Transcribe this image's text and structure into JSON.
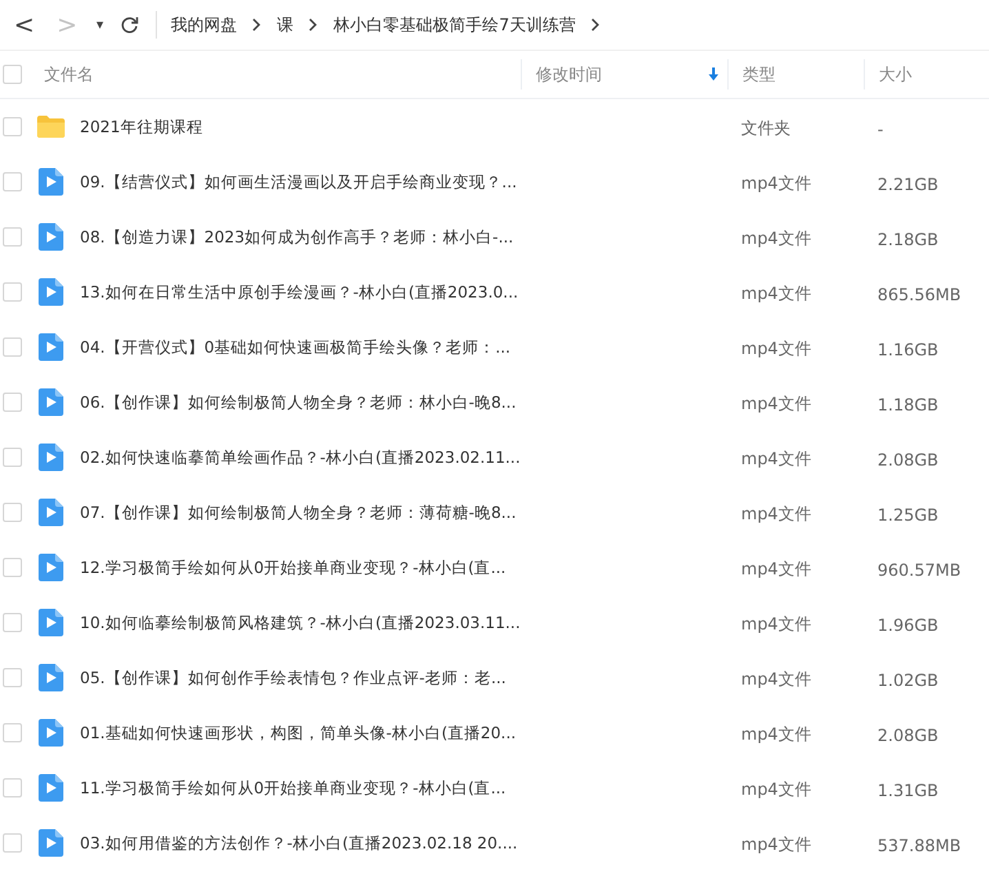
{
  "toolbar": {
    "back": {
      "label": "<",
      "disabled": false
    },
    "forward": {
      "label": ">",
      "disabled": true
    },
    "history": {
      "label": "▾"
    },
    "breadcrumb": [
      "我的网盘",
      "课",
      "林小白零基础极简手绘7天训练营"
    ]
  },
  "table": {
    "select_all": {
      "checked": false
    },
    "columns": [
      {
        "label": "文件名",
        "sorted": false
      },
      {
        "label": "修改时间",
        "sorted": true
      },
      {
        "label": "类型",
        "sorted": false
      },
      {
        "label": "大小",
        "sorted": false
      }
    ],
    "rows": [
      {
        "kind": "folder",
        "checked": false,
        "name": "2021年往期课程",
        "type": "文件夹",
        "size": "-"
      },
      {
        "kind": "video",
        "checked": false,
        "name": "09.【结营仪式】如何画生活漫画以及开启手绘商业变现？...",
        "type": "mp4文件",
        "size": "2.21GB"
      },
      {
        "kind": "video",
        "checked": false,
        "name": "08.【创造力课】2023如何成为创作高手？老师：林小白-...",
        "type": "mp4文件",
        "size": "2.18GB"
      },
      {
        "kind": "video",
        "checked": false,
        "name": "13.如何在日常生活中原创手绘漫画？-林小白(直播2023.0...",
        "type": "mp4文件",
        "size": "865.56MB"
      },
      {
        "kind": "video",
        "checked": false,
        "name": "04.【开营仪式】0基础如何快速画极简手绘头像？老师：...",
        "type": "mp4文件",
        "size": "1.16GB"
      },
      {
        "kind": "video",
        "checked": false,
        "name": "06.【创作课】如何绘制极简人物全身？老师：林小白-晚8...",
        "type": "mp4文件",
        "size": "1.18GB"
      },
      {
        "kind": "video",
        "checked": false,
        "name": "02.如何快速临摹简单绘画作品？-林小白(直播2023.02.11...",
        "type": "mp4文件",
        "size": "2.08GB"
      },
      {
        "kind": "video",
        "checked": false,
        "name": "07.【创作课】如何绘制极简人物全身？老师：薄荷糖-晚8...",
        "type": "mp4文件",
        "size": "1.25GB"
      },
      {
        "kind": "video",
        "checked": false,
        "name": "12.学习极简手绘如何从0开始接单商业变现？-林小白(直...",
        "type": "mp4文件",
        "size": "960.57MB"
      },
      {
        "kind": "video",
        "checked": false,
        "name": "10.如何临摹绘制极简风格建筑？-林小白(直播2023.03.11...",
        "type": "mp4文件",
        "size": "1.96GB"
      },
      {
        "kind": "video",
        "checked": false,
        "name": "05.【创作课】如何创作手绘表情包？作业点评-老师：老...",
        "type": "mp4文件",
        "size": "1.02GB"
      },
      {
        "kind": "video",
        "checked": false,
        "name": "01.基础如何快速画形状，构图，简单头像-林小白(直播20...",
        "type": "mp4文件",
        "size": "2.08GB"
      },
      {
        "kind": "video",
        "checked": false,
        "name": "11.学习极简手绘如何从0开始接单商业变现？-林小白(直...",
        "type": "mp4文件",
        "size": "1.31GB"
      },
      {
        "kind": "video",
        "checked": false,
        "name": "03.如何用借鉴的方法创作？-林小白(直播2023.02.18 20....",
        "type": "mp4文件",
        "size": "537.88MB"
      }
    ]
  }
}
